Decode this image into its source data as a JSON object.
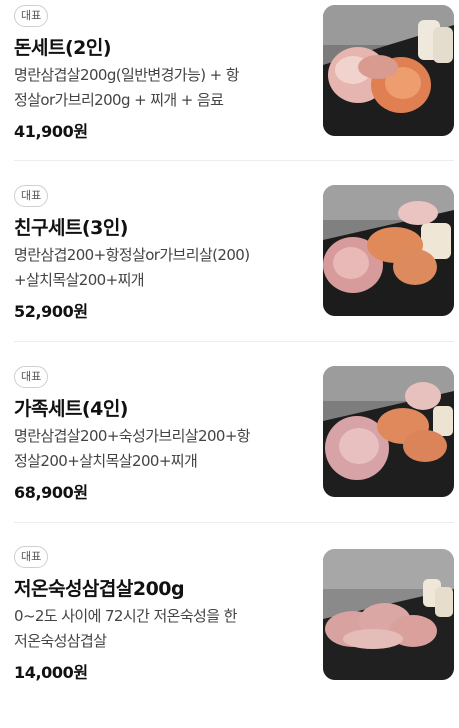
{
  "menu": {
    "items": [
      {
        "badge": "대표",
        "title": "돈세트(2인)",
        "desc_line1": "명란삼겹살200g(일반변경가능) + 항",
        "desc_line2": "정살or가브리200g + 찌개 + 음료",
        "price": "41,900원",
        "image": "pork-platter-photo"
      },
      {
        "badge": "대표",
        "title": "친구세트(3인)",
        "desc_line1": "명란삼겹200+항정살or가브리살(200)",
        "desc_line2": "+살치목살200+찌개",
        "price": "52,900원",
        "image": "pork-platter-photo"
      },
      {
        "badge": "대표",
        "title": "가족세트(4인)",
        "desc_line1": "명란삼겹살200+숙성가브리살200+항",
        "desc_line2": "정살200+살치목살200+찌개",
        "price": "68,900원",
        "image": "pork-platter-photo"
      },
      {
        "badge": "대표",
        "title": "저온숙성삼겹살200g",
        "desc_line1": "0~2도 사이에 72시간 저온숙성을 한",
        "desc_line2": "저온숙성삼겹살",
        "price": "14,000원",
        "image": "pork-belly-photo"
      }
    ]
  },
  "colors": {
    "background": "#ffffff",
    "text_primary": "#111111",
    "text_secondary": "#444444",
    "divider": "#ececec",
    "badge_border": "#cfcfcf"
  }
}
